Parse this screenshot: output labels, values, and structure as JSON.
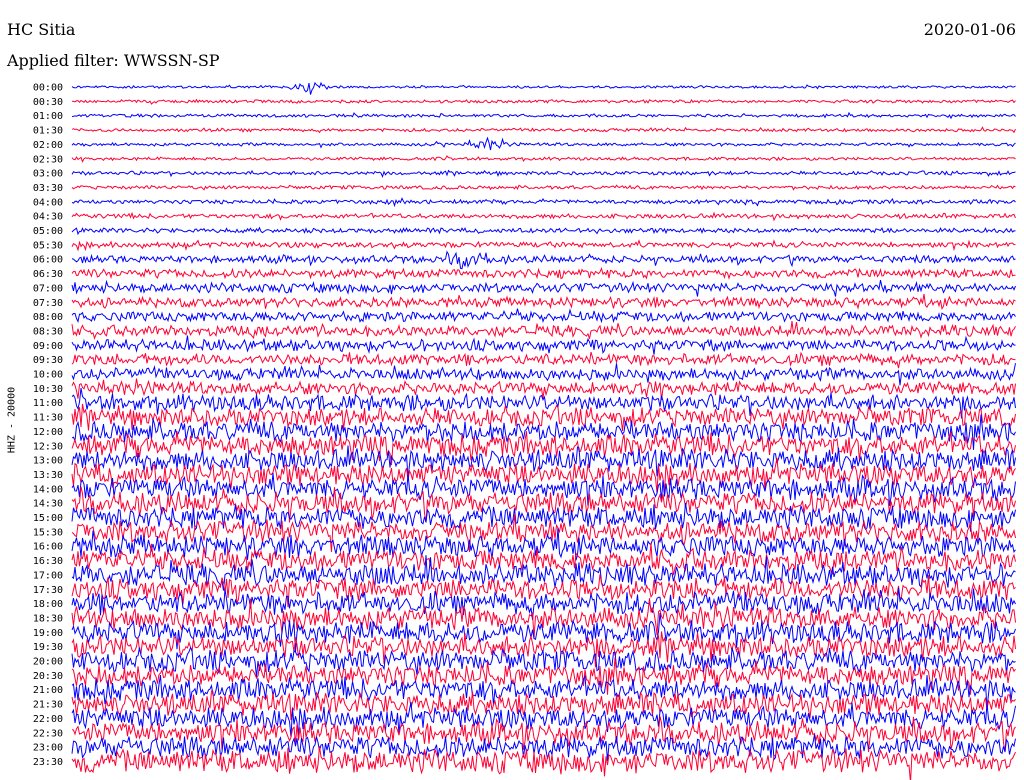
{
  "header": {
    "station": "HC Sitia",
    "date": "2020-01-06",
    "filter": "Applied filter: WWSSN-SP"
  },
  "chart_data": {
    "type": "line",
    "title": "HC Sitia",
    "ylabel": "HHZ - 20000",
    "row_labels": [
      "00:00",
      "00:30",
      "01:00",
      "01:30",
      "02:00",
      "02:30",
      "03:00",
      "03:30",
      "04:00",
      "04:30",
      "05:00",
      "05:30",
      "06:00",
      "06:30",
      "07:00",
      "07:30",
      "08:00",
      "08:30",
      "09:00",
      "09:30",
      "10:00",
      "10:30",
      "11:00",
      "11:30",
      "12:00",
      "12:30",
      "13:00",
      "13:30",
      "14:00",
      "14:30",
      "15:00",
      "15:30",
      "16:00",
      "16:30",
      "17:00",
      "17:30",
      "18:00",
      "18:30",
      "19:00",
      "19:30",
      "20:00",
      "20:30",
      "21:00",
      "21:30",
      "22:00",
      "22:30",
      "23:00",
      "23:30"
    ],
    "series_colors": [
      "#0000ff",
      "#ff0033"
    ],
    "relative_amplitude": [
      0.25,
      0.3,
      0.3,
      0.3,
      0.3,
      0.3,
      0.35,
      0.35,
      0.4,
      0.45,
      0.45,
      0.55,
      0.7,
      0.85,
      0.9,
      0.95,
      1.0,
      1.05,
      1.1,
      1.1,
      1.15,
      1.25,
      1.6,
      1.8,
      2.0,
      2.1,
      2.1,
      2.1,
      2.1,
      2.1,
      2.1,
      2.1,
      2.1,
      2.1,
      2.1,
      2.1,
      2.1,
      2.1,
      2.1,
      2.1,
      2.1,
      2.1,
      2.1,
      2.1,
      2.1,
      2.1,
      2.1,
      2.2
    ],
    "notable_events": [
      {
        "row": 0,
        "position": 0.25,
        "strength": 4.0
      },
      {
        "row": 4,
        "position": 0.44,
        "strength": 3.0
      },
      {
        "row": 12,
        "position": 0.42,
        "strength": 2.5
      }
    ]
  }
}
